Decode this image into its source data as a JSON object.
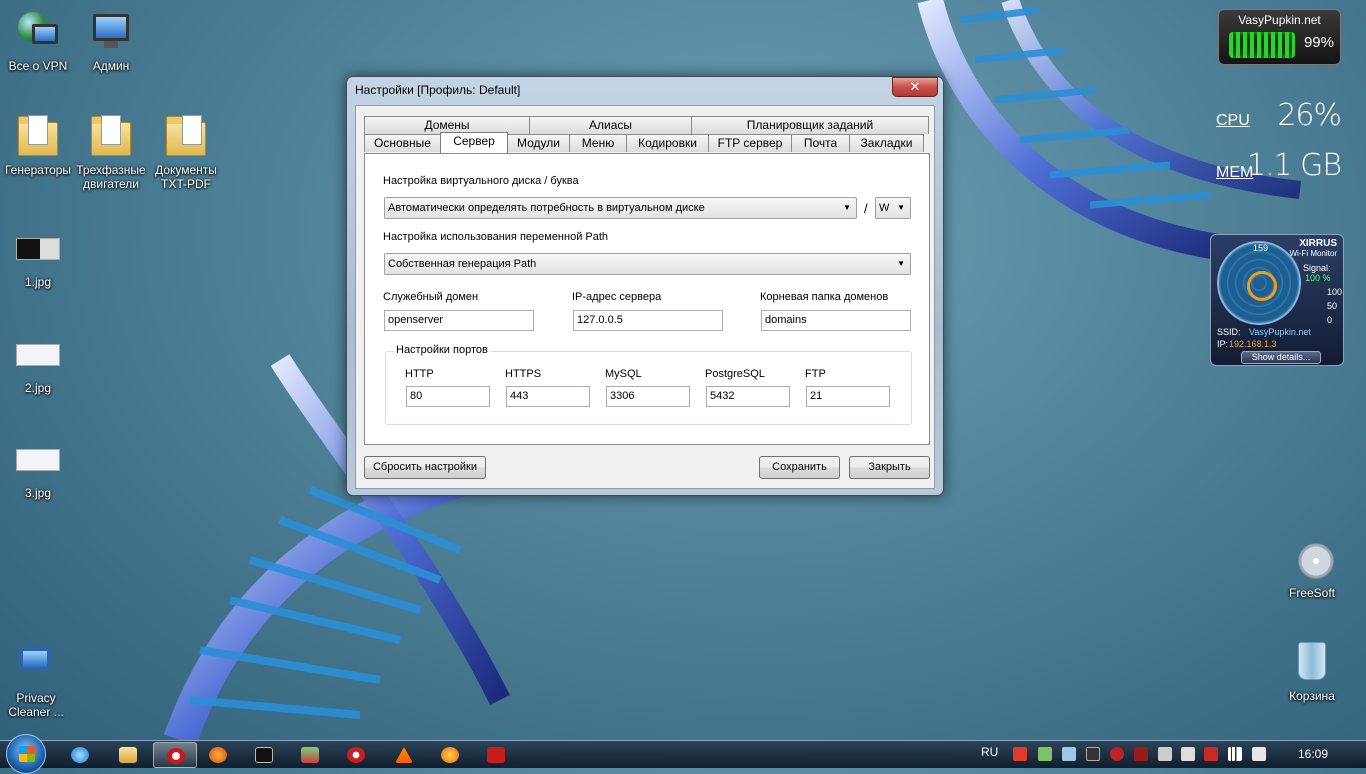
{
  "desktop": {
    "icons": [
      {
        "label": "Все о VPN"
      },
      {
        "label": "Админ"
      },
      {
        "label": "Генераторы"
      },
      {
        "label": "Трехфазные двигатели"
      },
      {
        "label": "Документы TXT-PDF"
      },
      {
        "label": "1.jpg"
      },
      {
        "label": "2.jpg"
      },
      {
        "label": "3.jpg"
      },
      {
        "label": "Privacy Cleaner ..."
      },
      {
        "label": "FreeSoft"
      },
      {
        "label": "Корзина"
      }
    ]
  },
  "gadgets": {
    "battery": {
      "title": "VasyPupkin.net",
      "percent": "99%"
    },
    "cpu": {
      "cpu_label": "CPU",
      "cpu_value": "26%",
      "mem_label": "MEM",
      "mem_value": "1.1 GB"
    },
    "wifi": {
      "brand": "XIRRUS",
      "subtitle": "Wi-Fi Monitor",
      "dial": "159",
      "signal_label": "Signal:",
      "signal_value": "100 %",
      "scale": [
        "100",
        "50",
        "0"
      ],
      "ssid_label": "SSID:",
      "ssid": "VasyPupkin.net",
      "ip_label": "IP:",
      "ip": "192.168.1.3",
      "show_details": "Show details..."
    }
  },
  "dialog": {
    "title": "Настройки [Профиль: Default]",
    "close": "✕",
    "tabs_row1": [
      "Домены",
      "Алиасы",
      "Планировщик заданий"
    ],
    "tabs_row2": [
      "Основные",
      "Сервер",
      "Модули",
      "Меню",
      "Кодировки",
      "FTP сервер",
      "Почта",
      "Закладки"
    ],
    "active_tab": "Сервер",
    "vdisk": {
      "label": "Настройка виртуального диска / буква",
      "value": "Автоматически определять потребность в виртуальном диске",
      "separator": "/",
      "letter": "W"
    },
    "path": {
      "label": "Настройка использования переменной Path",
      "value": "Собственная генерация Path"
    },
    "service_domain": {
      "label": "Служебный домен",
      "value": "openserver"
    },
    "server_ip": {
      "label": "IP-адрес сервера",
      "value": "127.0.0.5"
    },
    "root_folder": {
      "label": "Корневая папка доменов",
      "value": "domains"
    },
    "ports": {
      "title": "Настройки портов",
      "items": [
        {
          "label": "HTTP",
          "value": "80"
        },
        {
          "label": "HTTPS",
          "value": "443"
        },
        {
          "label": "MySQL",
          "value": "3306"
        },
        {
          "label": "PostgreSQL",
          "value": "5432"
        },
        {
          "label": "FTP",
          "value": "21"
        }
      ]
    },
    "buttons": {
      "reset": "Сбросить настройки",
      "save": "Сохранить",
      "close": "Закрыть"
    }
  },
  "taskbar": {
    "language": "RU",
    "clock": "16:09"
  }
}
